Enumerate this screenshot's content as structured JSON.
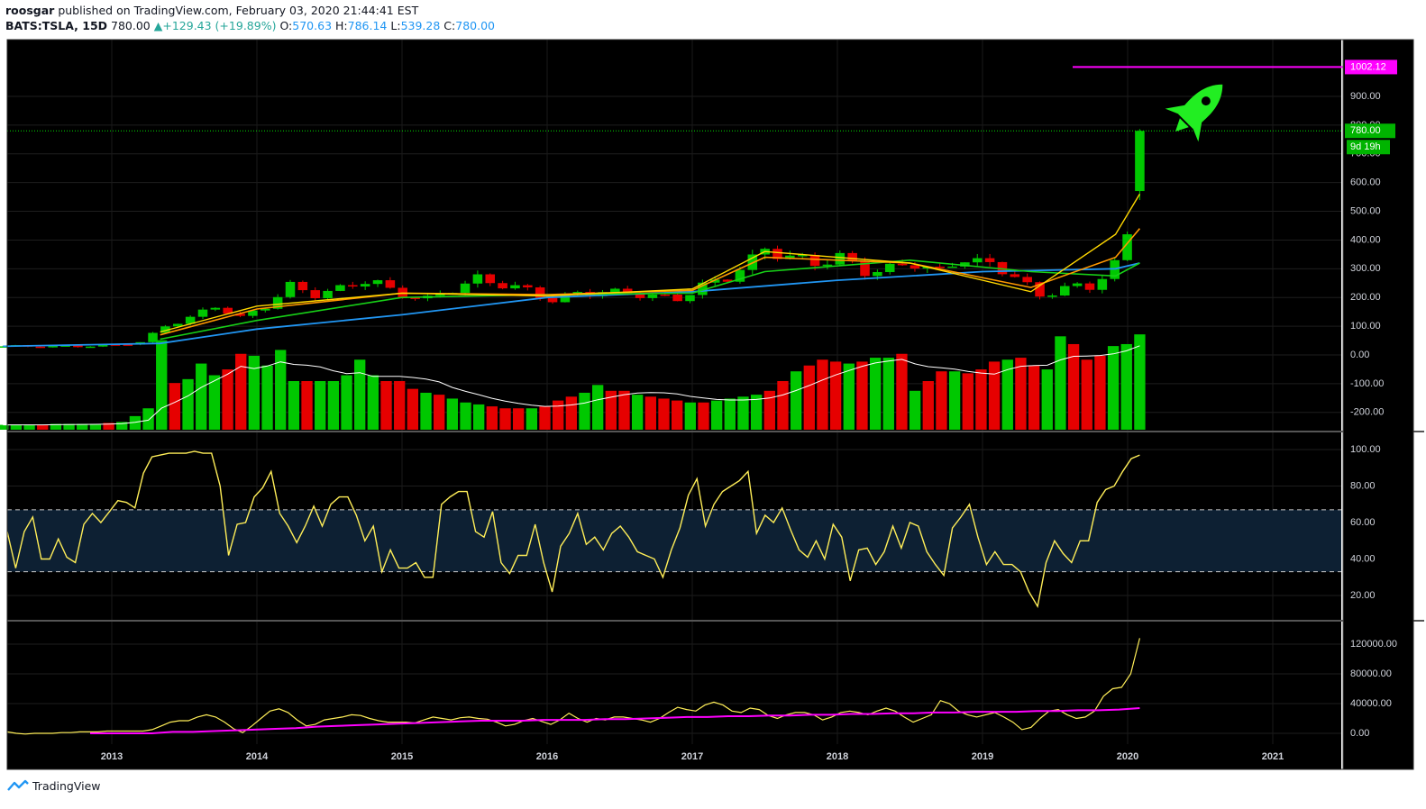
{
  "header": {
    "author": "roosgar",
    "published_text": "published on TradingView.com, February 03, 2020 21:44:41 EST",
    "symbol": "BATS:TSLA, 15D",
    "last": "780.00",
    "change_arrow": "▲",
    "change": "+129.43 (+19.89%)",
    "o_label": "O:",
    "o_value": "570.63",
    "h_label": "H:",
    "h_value": "786.14",
    "l_label": "L:",
    "l_value": "539.28",
    "c_label": "C:",
    "c_value": "780.00"
  },
  "footer": {
    "brand": "TradingView",
    "logo_icon": "tradingview-logo-icon"
  },
  "colors": {
    "background": "#000000",
    "up": "#00c800",
    "down": "#e60000",
    "ema_fast": "#ffd700",
    "ema_mid": "#ff9800",
    "ema_slow": "#17d117",
    "sma_long": "#2196f3",
    "target_line": "#ff00ff",
    "rsi": "#ffee58",
    "rsi_band": "#0d2033",
    "volume_ma": "#ffffff"
  },
  "icons": {
    "rocket": "rocket-icon"
  },
  "chart_data": [
    {
      "type": "candlestick",
      "title": "BATS:TSLA, 15D",
      "x_ticks": [
        "2013",
        "2014",
        "2015",
        "2016",
        "2017",
        "2018",
        "2019",
        "2020",
        "2021"
      ],
      "y_ticks": [
        "900.00",
        "800.00",
        "700.00",
        "600.00",
        "500.00",
        "400.00",
        "300.00",
        "200.00",
        "100.00",
        "0.00",
        "-100.00",
        "-200.00"
      ],
      "ylim": [
        -260,
        1050
      ],
      "price_labels": {
        "target": "1002.12",
        "last": "780.00",
        "countdown": "9d 19h"
      },
      "target_level": 1002.12,
      "last_price": 780.0,
      "price_path": [
        [
          "2012-04",
          30
        ],
        [
          "2012-10",
          30
        ],
        [
          "2013-01",
          35
        ],
        [
          "2013-03",
          45
        ],
        [
          "2013-05",
          100
        ],
        [
          "2013-07",
          130
        ],
        [
          "2013-09",
          170
        ],
        [
          "2013-11",
          130
        ],
        [
          "2014-01",
          170
        ],
        [
          "2014-03",
          240
        ],
        [
          "2014-05",
          210
        ],
        [
          "2014-07",
          230
        ],
        [
          "2014-09",
          260
        ],
        [
          "2014-11",
          240
        ],
        [
          "2015-01",
          210
        ],
        [
          "2015-03",
          195
        ],
        [
          "2015-05",
          230
        ],
        [
          "2015-07",
          265
        ],
        [
          "2015-09",
          245
        ],
        [
          "2015-11",
          225
        ],
        [
          "2016-01",
          190
        ],
        [
          "2016-03",
          215
        ],
        [
          "2016-05",
          220
        ],
        [
          "2016-07",
          215
        ],
        [
          "2016-09",
          205
        ],
        [
          "2016-11",
          195
        ],
        [
          "2017-01",
          240
        ],
        [
          "2017-03",
          270
        ],
        [
          "2017-05",
          330
        ],
        [
          "2017-07",
          370
        ],
        [
          "2017-09",
          340
        ],
        [
          "2017-11",
          320
        ],
        [
          "2018-01",
          340
        ],
        [
          "2018-03",
          290
        ],
        [
          "2018-05",
          300
        ],
        [
          "2018-07",
          320
        ],
        [
          "2018-09",
          290
        ],
        [
          "2018-11",
          340
        ],
        [
          "2019-01",
          310
        ],
        [
          "2019-03",
          280
        ],
        [
          "2019-05",
          200
        ],
        [
          "2019-07",
          240
        ],
        [
          "2019-09",
          230
        ],
        [
          "2019-11",
          330
        ],
        [
          "2019-12",
          420
        ],
        [
          "2020-01",
          570
        ],
        [
          "2020-02",
          780
        ]
      ],
      "ema_fast_path": [
        [
          "2013-05",
          80
        ],
        [
          "2014-01",
          170
        ],
        [
          "2015-01",
          215
        ],
        [
          "2016-01",
          205
        ],
        [
          "2017-01",
          230
        ],
        [
          "2017-07",
          360
        ],
        [
          "2018-07",
          320
        ],
        [
          "2019-05",
          220
        ],
        [
          "2019-12",
          420
        ],
        [
          "2020-02",
          560
        ]
      ],
      "ema_mid_path": [
        [
          "2013-05",
          70
        ],
        [
          "2014-01",
          160
        ],
        [
          "2015-01",
          215
        ],
        [
          "2016-01",
          210
        ],
        [
          "2017-01",
          225
        ],
        [
          "2017-07",
          340
        ],
        [
          "2018-07",
          320
        ],
        [
          "2019-05",
          235
        ],
        [
          "2019-12",
          340
        ],
        [
          "2020-02",
          440
        ]
      ],
      "ema_slow_path": [
        [
          "2013-05",
          55
        ],
        [
          "2014-01",
          120
        ],
        [
          "2015-01",
          200
        ],
        [
          "2016-01",
          210
        ],
        [
          "2017-01",
          215
        ],
        [
          "2017-07",
          290
        ],
        [
          "2018-07",
          330
        ],
        [
          "2019-05",
          290
        ],
        [
          "2019-12",
          275
        ],
        [
          "2020-02",
          320
        ]
      ],
      "sma_long_path": [
        [
          "2012-04",
          30
        ],
        [
          "2013-05",
          40
        ],
        [
          "2014-01",
          90
        ],
        [
          "2015-01",
          140
        ],
        [
          "2016-01",
          200
        ],
        [
          "2017-01",
          220
        ],
        [
          "2018-01",
          260
        ],
        [
          "2019-01",
          290
        ],
        [
          "2019-12",
          300
        ],
        [
          "2020-02",
          320
        ]
      ],
      "volume_relative": [
        0.05,
        0.05,
        0.05,
        0.05,
        0.06,
        0.06,
        0.06,
        0.06,
        0.07,
        0.08,
        0.14,
        0.22,
        0.92,
        0.48,
        0.52,
        0.68,
        0.56,
        0.62,
        0.78,
        0.76,
        0.66,
        0.82,
        0.5,
        0.5,
        0.5,
        0.5,
        0.56,
        0.72,
        0.56,
        0.5,
        0.5,
        0.42,
        0.38,
        0.36,
        0.32,
        0.28,
        0.26,
        0.24,
        0.22,
        0.22,
        0.22,
        0.24,
        0.3,
        0.34,
        0.38,
        0.46,
        0.4,
        0.4,
        0.36,
        0.34,
        0.32,
        0.3,
        0.28,
        0.28,
        0.3,
        0.32,
        0.34,
        0.36,
        0.4,
        0.5,
        0.6,
        0.66,
        0.72,
        0.7,
        0.68,
        0.7,
        0.74,
        0.74,
        0.78,
        0.4,
        0.5,
        0.6,
        0.6,
        0.58,
        0.62,
        0.7,
        0.72,
        0.74,
        0.66,
        0.62,
        0.96,
        0.88,
        0.72,
        0.76,
        0.86,
        0.88,
        0.98
      ]
    },
    {
      "type": "line",
      "title": "",
      "y_ticks": [
        "100.00",
        "80.00",
        "60.00",
        "40.00",
        "20.00"
      ],
      "ylim": [
        10,
        103
      ],
      "band": [
        33,
        67
      ],
      "values": [
        55,
        35,
        55,
        63,
        40,
        40,
        51,
        41,
        38,
        59,
        65,
        60,
        66,
        72,
        71,
        68,
        87,
        96,
        97,
        98,
        98,
        98,
        99,
        98,
        98,
        80,
        42,
        59,
        60,
        74,
        79,
        88,
        65,
        58,
        49,
        58,
        69,
        58,
        70,
        74,
        74,
        64,
        50,
        58,
        33,
        45,
        35,
        35,
        38,
        30,
        30,
        70,
        74,
        77,
        77,
        55,
        52,
        66,
        38,
        32,
        42,
        42,
        59,
        38,
        22,
        47,
        54,
        65,
        48,
        52,
        45,
        54,
        58,
        52,
        44,
        42,
        40,
        30,
        45,
        57,
        75,
        84,
        58,
        70,
        77,
        80,
        83,
        88,
        54,
        64,
        60,
        68,
        56,
        45,
        41,
        50,
        40,
        59,
        52,
        28,
        45,
        46,
        37,
        44,
        58,
        46,
        60,
        58,
        44,
        37,
        31,
        57,
        63,
        70,
        52,
        37,
        44,
        37,
        37,
        33,
        22,
        14,
        38,
        50,
        43,
        38,
        50,
        50,
        71,
        78,
        80,
        88,
        95,
        97
      ],
      "x_end": "2020-02"
    },
    {
      "type": "line",
      "title": "",
      "y_ticks": [
        "120000.00",
        "80000.00",
        "40000.00",
        "0.00"
      ],
      "ylim": [
        -8000,
        132000
      ],
      "series": [
        {
          "values": [
            2000,
            0,
            -1000,
            0,
            0,
            0,
            1000,
            1000,
            2000,
            2000,
            2000,
            3000,
            3000,
            3000,
            3000,
            3000,
            5000,
            10000,
            15000,
            17000,
            17000,
            22000,
            25000,
            22000,
            15000,
            6000,
            1000,
            10000,
            20000,
            30000,
            33000,
            28000,
            18000,
            10000,
            12000,
            18000,
            20000,
            22000,
            25000,
            24000,
            20000,
            17000,
            15000,
            15000,
            15000,
            14000,
            18000,
            22000,
            20000,
            18000,
            21000,
            22000,
            20000,
            19000,
            15000,
            10000,
            12000,
            17000,
            20000,
            16000,
            12000,
            18000,
            27000,
            20000,
            15000,
            20000,
            18000,
            22000,
            22000,
            20000,
            18000,
            15000,
            20000,
            28000,
            35000,
            32000,
            30000,
            38000,
            42000,
            38000,
            30000,
            28000,
            34000,
            32000,
            24000,
            20000,
            25000,
            28000,
            28000,
            25000,
            18000,
            22000,
            28000,
            30000,
            28000,
            25000,
            30000,
            34000,
            30000,
            22000,
            15000,
            20000,
            25000,
            44000,
            40000,
            30000,
            25000,
            22000,
            25000,
            28000,
            22000,
            15000,
            5000,
            8000,
            20000,
            30000,
            32000,
            25000,
            20000,
            22000,
            30000,
            50000,
            60000,
            62000,
            80000,
            128000
          ]
        },
        {
          "values": [
            0,
            0,
            0,
            0,
            2000,
            2000,
            3000,
            4000,
            5000,
            6000,
            7000,
            9000,
            10000,
            11000,
            12000,
            13000,
            14000,
            15000,
            16000,
            17000,
            17000,
            17000,
            18000,
            18000,
            18000,
            19000,
            19000,
            20000,
            21000,
            22000,
            22000,
            23000,
            23000,
            24000,
            24000,
            25000,
            25000,
            26000,
            26000,
            27000,
            27000,
            28000,
            28000,
            29000,
            29000,
            29000,
            30000,
            30000,
            31000,
            31000,
            32000,
            34000
          ]
        }
      ]
    }
  ]
}
